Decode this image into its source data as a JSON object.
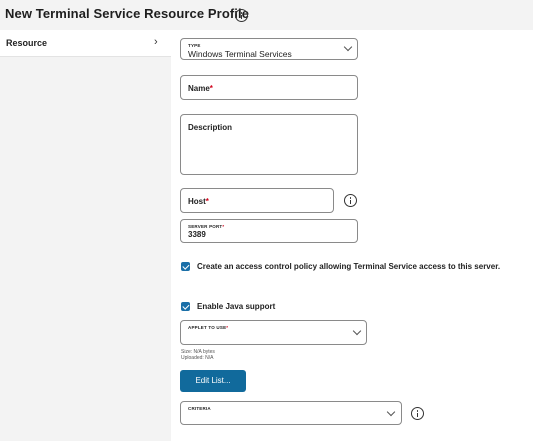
{
  "page": {
    "title": "New Terminal Service Resource Profile"
  },
  "sidebar": {
    "items": [
      {
        "label": "Resource",
        "chevron": "›"
      }
    ]
  },
  "form": {
    "type": {
      "label": "TYPE",
      "value": "Windows Terminal Services"
    },
    "name": {
      "placeholder": "Name",
      "required_mark": "*"
    },
    "description": {
      "placeholder": "Description"
    },
    "host": {
      "placeholder": "Host",
      "required_mark": "*"
    },
    "server_port": {
      "label": "SERVER PORT",
      "required_mark": "*",
      "value": "3389"
    },
    "access_policy_checkbox": {
      "label": "Create an access control policy allowing Terminal Service access to this server.",
      "checked": true
    },
    "java_support_checkbox": {
      "label": "Enable Java support",
      "checked": true
    },
    "applet_to_use": {
      "label": "APPLET TO USE",
      "required_mark": "*",
      "value": ""
    },
    "applet_meta": {
      "size": "Size: N/A bytes",
      "uploaded": "Uploaded: N/A"
    },
    "edit_list_button": {
      "label": "Edit List..."
    },
    "criteria": {
      "label": "CRITERIA",
      "value": ""
    }
  },
  "colors": {
    "accent": "#116a9c",
    "checkbox": "#1a6fa8",
    "required": "#d0021b"
  },
  "icons": {
    "title_info": "info-icon",
    "host_info": "info-icon",
    "criteria_info": "info-icon"
  }
}
